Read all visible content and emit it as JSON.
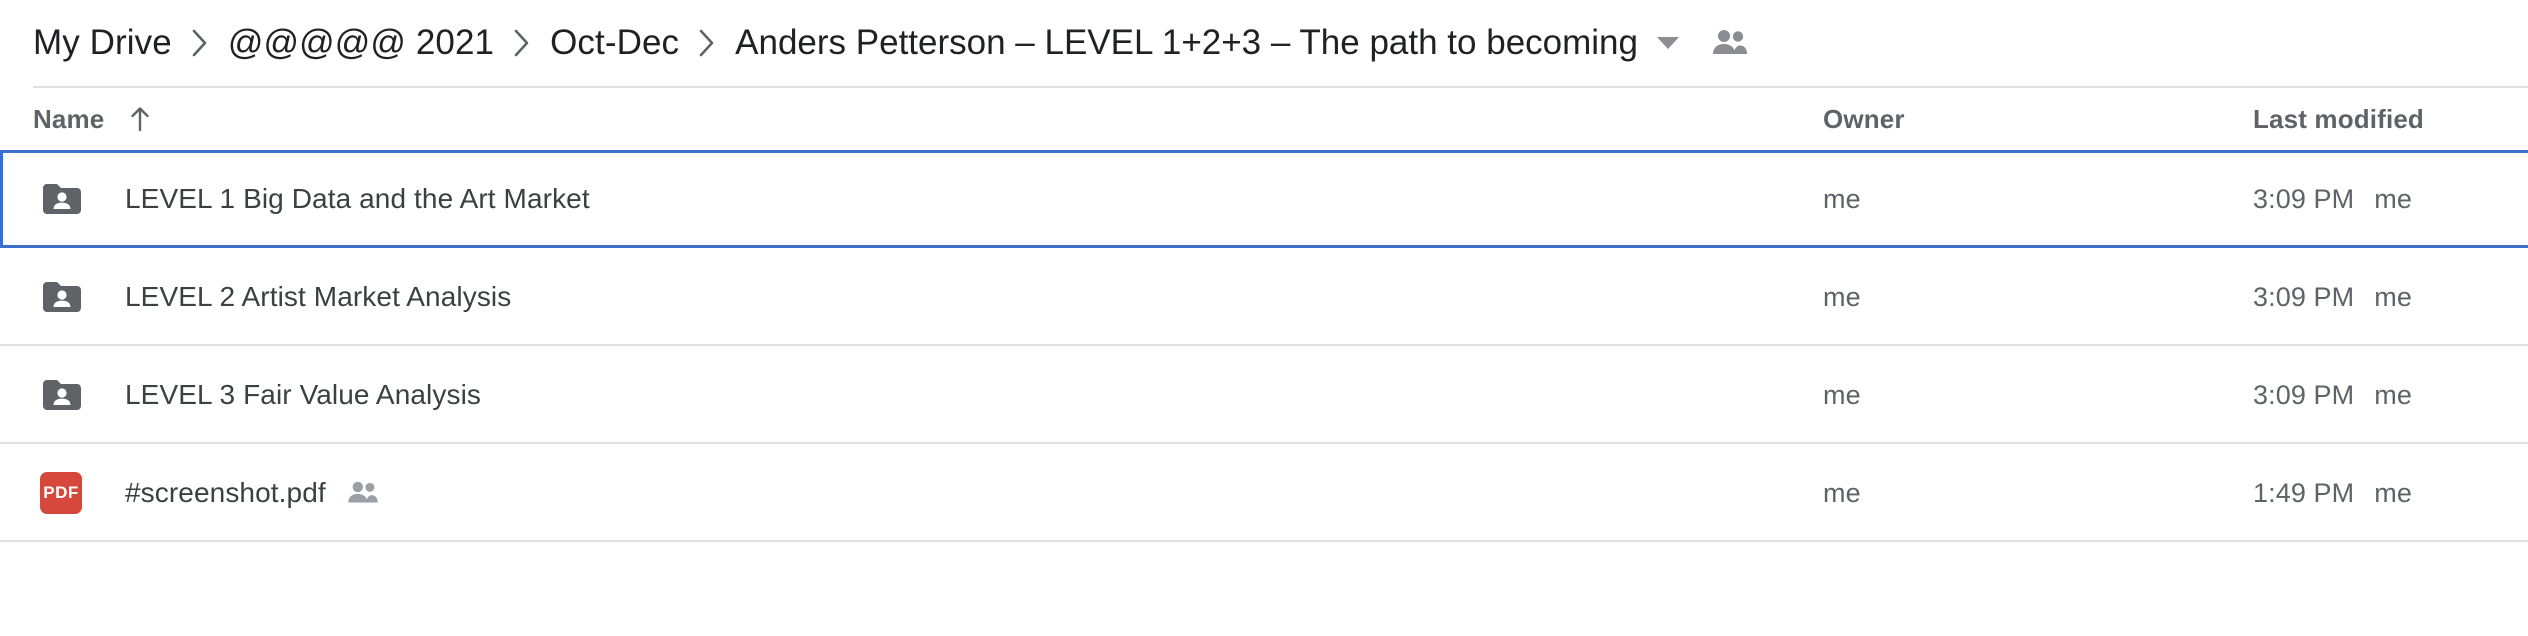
{
  "breadcrumb": {
    "items": [
      {
        "label": "My Drive",
        "current": false
      },
      {
        "label": "@@@@@ 2021",
        "current": false
      },
      {
        "label": "Oct-Dec",
        "current": false
      },
      {
        "label": "Anders Petterson – LEVEL 1+2+3 – The path to becoming",
        "current": true
      }
    ],
    "separator_icon": "chevron-right-icon",
    "dropdown_icon": "chevron-down-icon",
    "shared_icon": "people-shared-icon"
  },
  "columns": {
    "name": "Name",
    "owner": "Owner",
    "modified": "Last modified",
    "sort_icon": "arrow-up-icon"
  },
  "colors": {
    "selection_border": "#3b6fcb",
    "folder_icon": "#5f6368",
    "pdf_icon": "#d7483c",
    "divider": "#e0e0e3",
    "secondary_text": "#5f6368",
    "primary_text": "#3c4043"
  },
  "files": [
    {
      "name": "LEVEL 1 Big Data and the Art Market",
      "icon": "shared-folder-icon",
      "type": "folder",
      "shared_badge": false,
      "owner": "me",
      "modified_time": "3:09 PM",
      "modified_by": "me",
      "selected": true
    },
    {
      "name": "LEVEL 2 Artist Market Analysis",
      "icon": "shared-folder-icon",
      "type": "folder",
      "shared_badge": false,
      "owner": "me",
      "modified_time": "3:09 PM",
      "modified_by": "me",
      "selected": false
    },
    {
      "name": "LEVEL 3 Fair Value Analysis",
      "icon": "shared-folder-icon",
      "type": "folder",
      "shared_badge": false,
      "owner": "me",
      "modified_time": "3:09 PM",
      "modified_by": "me",
      "selected": false
    },
    {
      "name": "#screenshot.pdf",
      "icon": "pdf-file-icon",
      "icon_label": "PDF",
      "type": "pdf",
      "shared_badge": true,
      "owner": "me",
      "modified_time": "1:49 PM",
      "modified_by": "me",
      "selected": false
    }
  ]
}
